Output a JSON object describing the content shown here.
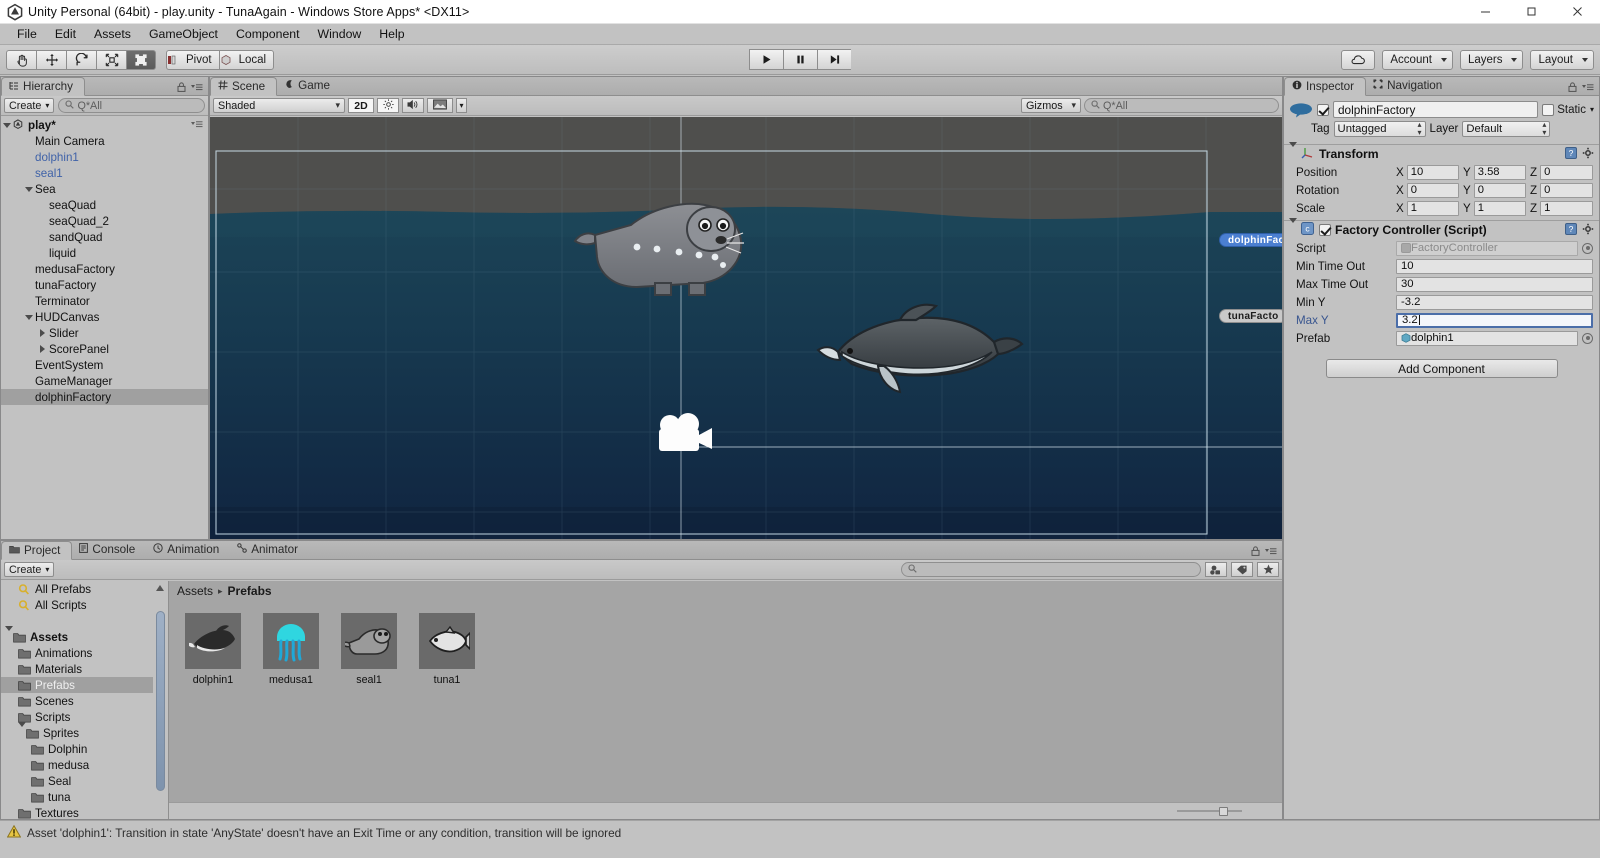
{
  "window": {
    "title": "Unity Personal (64bit) - play.unity - TunaAgain - Windows Store Apps* <DX11>",
    "minimize": "—",
    "maximize": "❐",
    "close": "✕"
  },
  "menubar": {
    "items": [
      "File",
      "Edit",
      "Assets",
      "GameObject",
      "Component",
      "Window",
      "Help"
    ]
  },
  "toolbar": {
    "tools": [
      {
        "name": "hand-tool",
        "icon": "hand-icon",
        "active": false
      },
      {
        "name": "move-tool",
        "icon": "move-icon",
        "active": false
      },
      {
        "name": "rotate-tool",
        "icon": "rotate-icon",
        "active": false
      },
      {
        "name": "scale-tool",
        "icon": "scale-icon",
        "active": false
      },
      {
        "name": "rect-tool",
        "icon": "rect-transform-icon",
        "active": true
      }
    ],
    "pivot_label": "Pivot",
    "local_label": "Local",
    "play_label": "▶",
    "pause_label": "❚❚",
    "step_label": "▶❙",
    "cloud_label": "cloud-icon",
    "account_label": "Account",
    "layers_label": "Layers",
    "layout_label": "Layout"
  },
  "hierarchy": {
    "tab_label": "Hierarchy",
    "create_label": "Create",
    "search_placeholder": "Q*All",
    "root": "play*",
    "items": [
      {
        "label": "Main Camera",
        "depth": 1,
        "twisty": "none",
        "prefab": false,
        "selected": false
      },
      {
        "label": "dolphin1",
        "depth": 1,
        "twisty": "none",
        "prefab": true,
        "selected": false
      },
      {
        "label": "seal1",
        "depth": 1,
        "twisty": "none",
        "prefab": true,
        "selected": false
      },
      {
        "label": "Sea",
        "depth": 1,
        "twisty": "down",
        "prefab": false,
        "selected": false
      },
      {
        "label": "seaQuad",
        "depth": 2,
        "twisty": "none",
        "prefab": false,
        "selected": false
      },
      {
        "label": "seaQuad_2",
        "depth": 2,
        "twisty": "none",
        "prefab": false,
        "selected": false
      },
      {
        "label": "sandQuad",
        "depth": 2,
        "twisty": "none",
        "prefab": false,
        "selected": false
      },
      {
        "label": "liquid",
        "depth": 2,
        "twisty": "none",
        "prefab": false,
        "selected": false
      },
      {
        "label": "medusaFactory",
        "depth": 1,
        "twisty": "none",
        "prefab": false,
        "selected": false
      },
      {
        "label": "tunaFactory",
        "depth": 1,
        "twisty": "none",
        "prefab": false,
        "selected": false
      },
      {
        "label": "Terminator",
        "depth": 1,
        "twisty": "none",
        "prefab": false,
        "selected": false
      },
      {
        "label": "HUDCanvas",
        "depth": 1,
        "twisty": "down",
        "prefab": false,
        "selected": false
      },
      {
        "label": "Slider",
        "depth": 2,
        "twisty": "right",
        "prefab": false,
        "selected": false
      },
      {
        "label": "ScorePanel",
        "depth": 2,
        "twisty": "right",
        "prefab": false,
        "selected": false
      },
      {
        "label": "EventSystem",
        "depth": 1,
        "twisty": "none",
        "prefab": false,
        "selected": false
      },
      {
        "label": "GameManager",
        "depth": 1,
        "twisty": "none",
        "prefab": false,
        "selected": false
      },
      {
        "label": "dolphinFactory",
        "depth": 1,
        "twisty": "none",
        "prefab": false,
        "selected": true
      }
    ]
  },
  "scene": {
    "tabs": [
      {
        "label": "Scene",
        "icon": "grid-icon",
        "active": true
      },
      {
        "label": "Game",
        "icon": "gamepad-icon",
        "active": false
      }
    ],
    "shading_mode": "Shaded",
    "mode_2d": "2D",
    "lighting_icon": "sun-icon",
    "audio_icon": "speaker-icon",
    "effects_icon": "image-icon",
    "gizmos_label": "Gizmos",
    "gizmos_search_placeholder": "Q*All",
    "object_labels": [
      {
        "text": "dolphinFac",
        "selected": true
      },
      {
        "text": "tunaFacto",
        "selected": false
      }
    ],
    "sprites": [
      "seal",
      "dolphin",
      "camera-gizmo"
    ]
  },
  "inspector": {
    "tabs": [
      {
        "label": "Inspector",
        "icon": "info-icon",
        "active": true
      },
      {
        "label": "Navigation",
        "icon": "navigation-icon",
        "active": false
      }
    ],
    "object_name": "dolphinFactory",
    "object_enabled": true,
    "static_label": "Static",
    "tag_label": "Tag",
    "tag_value": "Untagged",
    "layer_label": "Layer",
    "layer_value": "Default",
    "transform": {
      "title": "Transform",
      "rows": [
        {
          "label": "Position",
          "x": "10",
          "y": "3.58",
          "z": "0"
        },
        {
          "label": "Rotation",
          "x": "0",
          "y": "0",
          "z": "0"
        },
        {
          "label": "Scale",
          "x": "1",
          "y": "1",
          "z": "1"
        }
      ],
      "axis_labels": [
        "X",
        "Y",
        "Z"
      ]
    },
    "script_component": {
      "title": "Factory Controller (Script)",
      "enabled": true,
      "fields": [
        {
          "label": "Script",
          "value": "FactoryController",
          "type": "object",
          "disabled": true,
          "focused": false
        },
        {
          "label": "Min Time Out",
          "value": "10",
          "type": "text",
          "disabled": false,
          "focused": false
        },
        {
          "label": "Max Time Out",
          "value": "30",
          "type": "text",
          "disabled": false,
          "focused": false
        },
        {
          "label": "Min Y",
          "value": "-3.2",
          "type": "text",
          "disabled": false,
          "focused": false
        },
        {
          "label": "Max Y",
          "value": "3.2",
          "type": "text",
          "disabled": false,
          "focused": true
        },
        {
          "label": "Prefab",
          "value": "dolphin1",
          "type": "object",
          "disabled": false,
          "focused": false
        }
      ]
    },
    "add_component_label": "Add Component"
  },
  "project": {
    "tabs": [
      {
        "label": "Project",
        "icon": "folder-icon",
        "active": true
      },
      {
        "label": "Console",
        "icon": "console-icon",
        "active": false
      },
      {
        "label": "Animation",
        "icon": "clock-icon",
        "active": false
      },
      {
        "label": "Animator",
        "icon": "animator-icon",
        "active": false
      }
    ],
    "create_label": "Create",
    "search_placeholder": "",
    "tree": [
      {
        "label": "All Prefabs",
        "depth": 1,
        "icon": "search-saved",
        "twisty": "none",
        "bold": false,
        "selected": false
      },
      {
        "label": "All Scripts",
        "depth": 1,
        "icon": "search-saved",
        "twisty": "none",
        "bold": false,
        "selected": false
      },
      {
        "label": "",
        "depth": 0,
        "icon": "spacer",
        "twisty": "none",
        "bold": false,
        "selected": false
      },
      {
        "label": "Assets",
        "depth": 0,
        "icon": "folder",
        "twisty": "down",
        "bold": true,
        "selected": false
      },
      {
        "label": "Animations",
        "depth": 1,
        "icon": "folder",
        "twisty": "none",
        "bold": false,
        "selected": false
      },
      {
        "label": "Materials",
        "depth": 1,
        "icon": "folder",
        "twisty": "none",
        "bold": false,
        "selected": false
      },
      {
        "label": "Prefabs",
        "depth": 1,
        "icon": "folder",
        "twisty": "none",
        "bold": false,
        "selected": true
      },
      {
        "label": "Scenes",
        "depth": 1,
        "icon": "folder",
        "twisty": "none",
        "bold": false,
        "selected": false
      },
      {
        "label": "Scripts",
        "depth": 1,
        "icon": "folder",
        "twisty": "none",
        "bold": false,
        "selected": false
      },
      {
        "label": "Sprites",
        "depth": 1,
        "icon": "folder",
        "twisty": "down",
        "bold": false,
        "selected": false
      },
      {
        "label": "Dolphin",
        "depth": 2,
        "icon": "folder",
        "twisty": "none",
        "bold": false,
        "selected": false
      },
      {
        "label": "medusa",
        "depth": 2,
        "icon": "folder",
        "twisty": "none",
        "bold": false,
        "selected": false
      },
      {
        "label": "Seal",
        "depth": 2,
        "icon": "folder",
        "twisty": "none",
        "bold": false,
        "selected": false
      },
      {
        "label": "tuna",
        "depth": 2,
        "icon": "folder",
        "twisty": "none",
        "bold": false,
        "selected": false
      },
      {
        "label": "Textures",
        "depth": 1,
        "icon": "folder",
        "twisty": "none",
        "bold": false,
        "selected": false
      }
    ],
    "breadcrumb": {
      "root": "Assets",
      "sep": "▸",
      "current": "Prefabs"
    },
    "assets": [
      {
        "name": "dolphin1",
        "icon": "dolphin-sprite"
      },
      {
        "name": "medusa1",
        "icon": "jellyfish-sprite"
      },
      {
        "name": "seal1",
        "icon": "seal-sprite"
      },
      {
        "name": "tuna1",
        "icon": "tuna-sprite"
      }
    ]
  },
  "statusbar": {
    "icon": "warning-icon",
    "message": "Asset 'dolphin1': Transition in state 'AnyState' doesn't have an Exit Time or any condition, transition will be ignored"
  },
  "colors": {
    "chrome": "#c2c2c2",
    "selection": "#a0a0a0",
    "prefab_blue": "#3f62a8",
    "focus_blue": "#4b6ea9",
    "water_top": "#1d4152",
    "water_bottom": "#12263f",
    "warning_yellow": "#e8c84a"
  }
}
